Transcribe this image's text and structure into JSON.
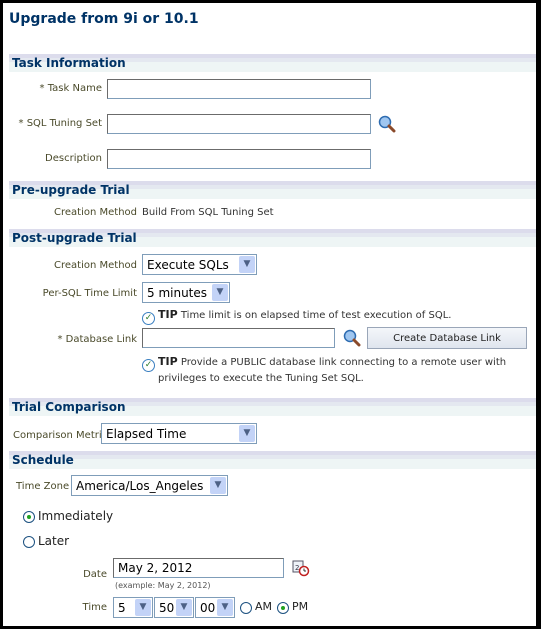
{
  "page": {
    "title": "Upgrade from 9i or 10.1"
  },
  "task_info": {
    "heading": "Task Information",
    "task_name_label": "* Task Name",
    "task_name_value": "",
    "sql_tuning_set_label": "* SQL Tuning Set",
    "sql_tuning_set_value": "",
    "description_label": "Description",
    "description_value": ""
  },
  "pre_upgrade": {
    "heading": "Pre-upgrade Trial",
    "creation_method_label": "Creation Method",
    "creation_method_value": "Build From SQL Tuning Set"
  },
  "post_upgrade": {
    "heading": "Post-upgrade Trial",
    "creation_method_label": "Creation Method",
    "creation_method_value": "Execute SQLs",
    "time_limit_label": "Per-SQL Time Limit",
    "time_limit_value": "5 minutes",
    "tip1_prefix": "TIP",
    "tip1_text": "Time limit is on elapsed time of test execution of SQL.",
    "db_link_label": "* Database Link",
    "db_link_value": "",
    "create_db_link_button": "Create Database Link",
    "tip2_prefix": "TIP",
    "tip2_line1": "Provide a PUBLIC database link connecting to a remote user with",
    "tip2_line2": "privileges to execute the Tuning Set SQL."
  },
  "trial_comparison": {
    "heading": "Trial Comparison",
    "metric_label": "Comparison Metric",
    "metric_value": "Elapsed Time"
  },
  "schedule": {
    "heading": "Schedule",
    "timezone_label": "Time Zone",
    "timezone_value": "America/Los_Angeles",
    "immediately_label": "Immediately",
    "immediately_selected": true,
    "later_label": "Later",
    "later_selected": false,
    "date_label": "Date",
    "date_value": "May 2, 2012",
    "date_hint": "(example: May 2, 2012)",
    "time_label": "Time",
    "hour_value": "5",
    "minute_value": "50",
    "second_value": "00",
    "am_label": "AM",
    "pm_label": "PM",
    "pm_selected": true
  }
}
